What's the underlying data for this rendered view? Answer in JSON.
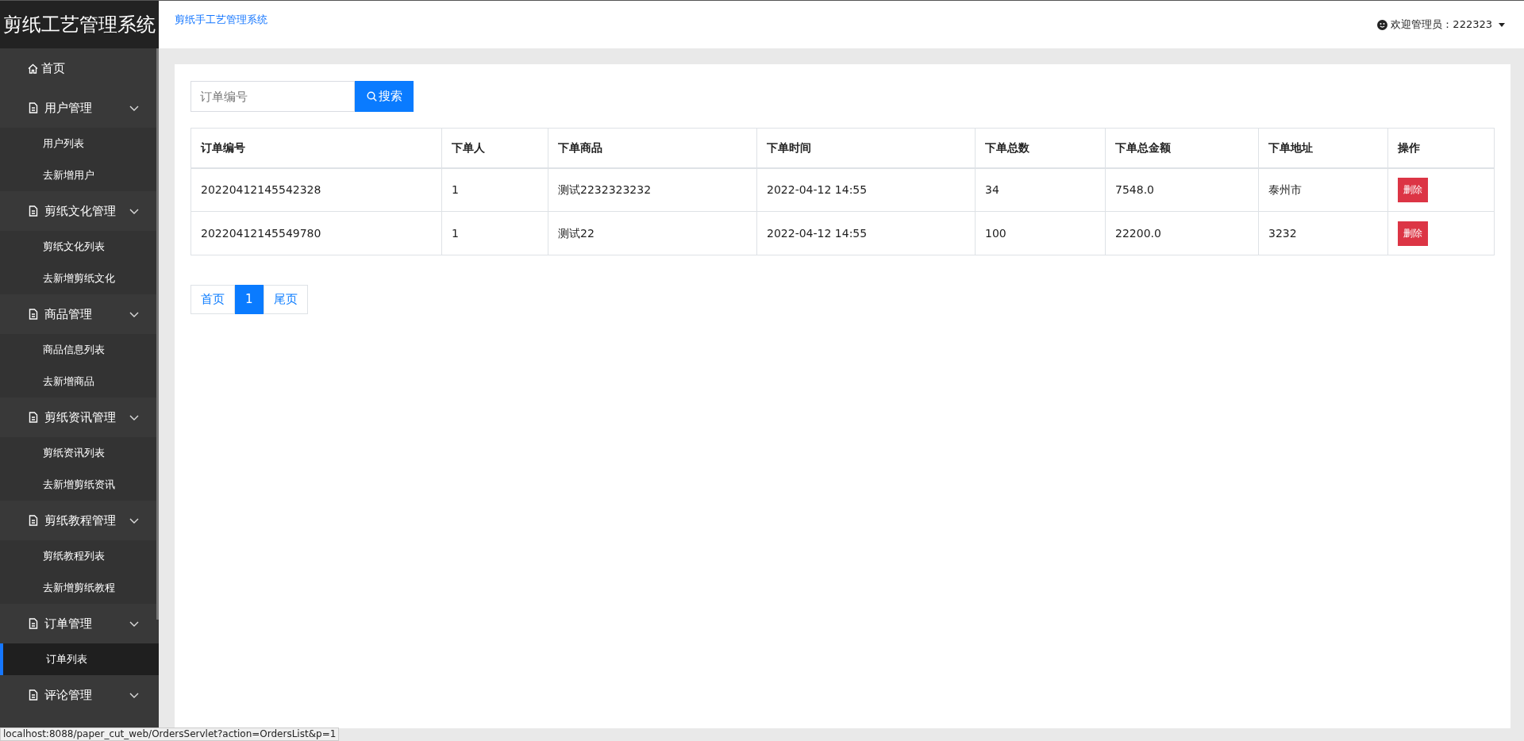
{
  "sidebar": {
    "brand": "剪纸工艺管理系统",
    "items": [
      {
        "kind": "link",
        "label": "首页"
      },
      {
        "kind": "group",
        "label": "用户管理",
        "expanded": true,
        "children": [
          {
            "label": "用户列表",
            "selected": false
          },
          {
            "label": "去新增用户",
            "selected": false
          }
        ]
      },
      {
        "kind": "group",
        "label": "剪纸文化管理",
        "expanded": true,
        "children": [
          {
            "label": "剪纸文化列表",
            "selected": false
          },
          {
            "label": "去新增剪纸文化",
            "selected": false
          }
        ]
      },
      {
        "kind": "group",
        "label": "商品管理",
        "expanded": true,
        "children": [
          {
            "label": "商品信息列表",
            "selected": false
          },
          {
            "label": "去新增商品",
            "selected": false
          }
        ]
      },
      {
        "kind": "group",
        "label": "剪纸资讯管理",
        "expanded": true,
        "children": [
          {
            "label": "剪纸资讯列表",
            "selected": false
          },
          {
            "label": "去新增剪纸资讯",
            "selected": false
          }
        ]
      },
      {
        "kind": "group",
        "label": "剪纸教程管理",
        "expanded": true,
        "children": [
          {
            "label": "剪纸教程列表",
            "selected": false
          },
          {
            "label": "去新增剪纸教程",
            "selected": false
          }
        ]
      },
      {
        "kind": "group",
        "label": "订单管理",
        "expanded": true,
        "children": [
          {
            "label": "订单列表",
            "selected": true
          }
        ]
      },
      {
        "kind": "group",
        "label": "评论管理",
        "expanded": true
      }
    ]
  },
  "header": {
    "title": "剪纸手工艺管理系统",
    "user": "欢迎管理员：222323"
  },
  "search": {
    "placeholder": "订单编号",
    "button": "搜索"
  },
  "table": {
    "columns": [
      "订单编号",
      "下单人",
      "下单商品",
      "下单时间",
      "下单总数",
      "下单总金额",
      "下单地址",
      "操作"
    ],
    "rows": [
      {
        "cells": [
          "20220412145542328",
          "1",
          "测试2232323232",
          "2022-04-12 14:55",
          "34",
          "7548.0",
          "泰州市"
        ],
        "action": "删除"
      },
      {
        "cells": [
          "20220412145549780",
          "1",
          "测试22",
          "2022-04-12 14:55",
          "100",
          "22200.0",
          "3232"
        ],
        "action": "删除"
      }
    ]
  },
  "pagination": [
    {
      "label": "首页",
      "selected": false
    },
    {
      "label": "1",
      "selected": true
    },
    {
      "label": "尾页",
      "selected": false
    }
  ],
  "status_url": "localhost:8088/paper_cut_web/OrdersServlet?action=OrdersList&p=1"
}
